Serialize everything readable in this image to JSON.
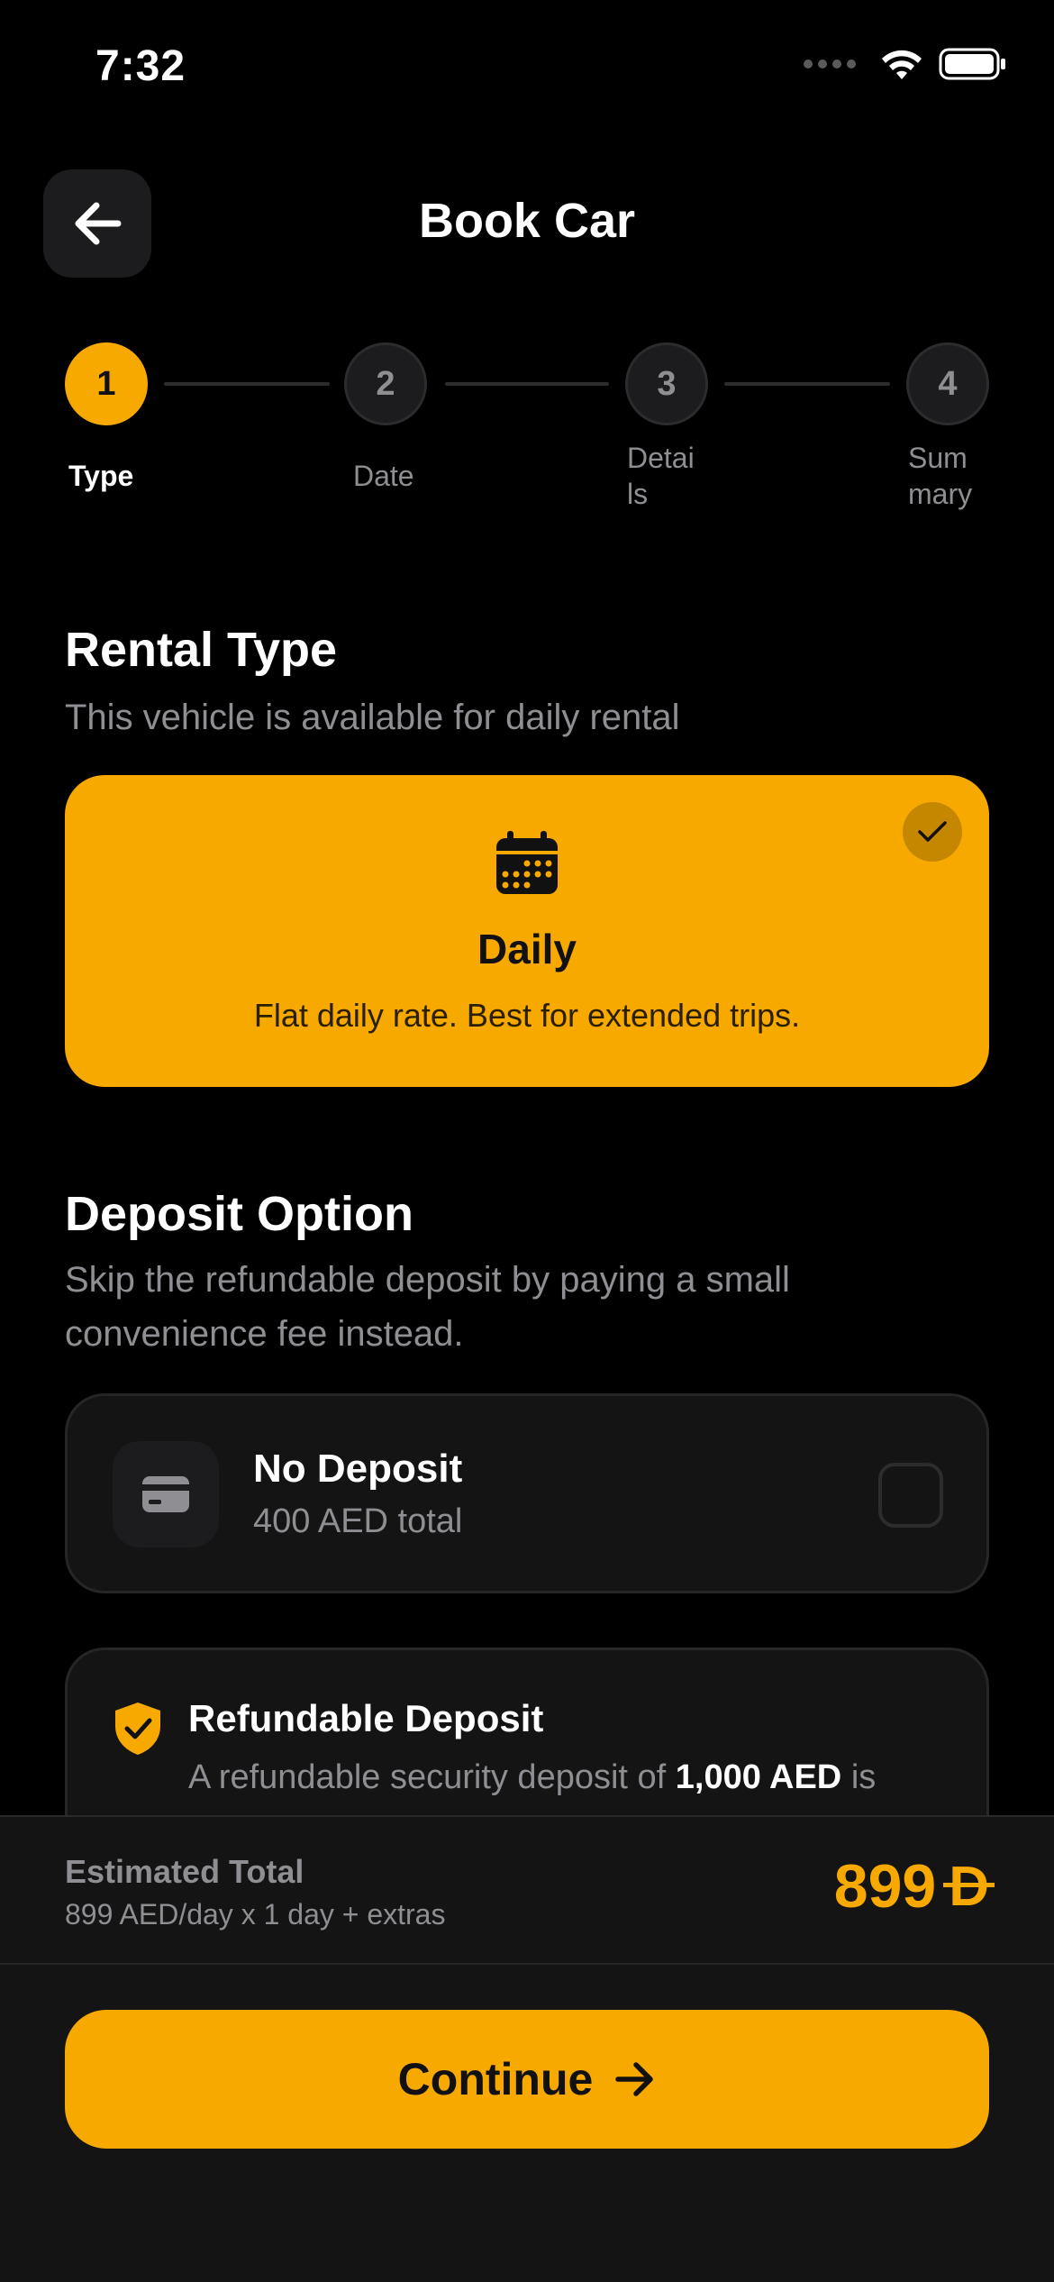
{
  "status_bar": {
    "time": "7:32"
  },
  "header": {
    "title": "Book Car",
    "back_icon": "arrow-left-icon"
  },
  "stepper": {
    "steps": [
      {
        "number": "1",
        "label": "Type",
        "active": true
      },
      {
        "number": "2",
        "label": "Date",
        "active": false
      },
      {
        "number": "3",
        "label": "Detai\nls",
        "active": false
      },
      {
        "number": "4",
        "label": "Sum\nmary",
        "active": false
      }
    ]
  },
  "rental_type": {
    "title": "Rental Type",
    "subtitle": "This vehicle is available for daily rental",
    "option": {
      "icon": "calendar-icon",
      "name": "Daily",
      "description": "Flat daily rate. Best for extended trips.",
      "selected": true
    }
  },
  "deposit": {
    "title": "Deposit Option",
    "subtitle": "Skip the refundable deposit by paying a small convenience fee instead.",
    "no_deposit": {
      "icon": "credit-card-icon",
      "title": "No Deposit",
      "subtitle": "400 AED total",
      "checked": false
    },
    "refundable": {
      "icon": "shield-check-icon",
      "title": "Refundable Deposit",
      "subtitle_before": "A refundable security deposit of ",
      "subtitle_amount": "1,000 AED",
      "subtitle_after": " is"
    }
  },
  "summary": {
    "label": "Estimated Total",
    "detail": "899 AED/day x 1 day + extras",
    "amount": "899",
    "currency_symbol": "D"
  },
  "continue": {
    "label": "Continue",
    "icon": "arrow-right-icon"
  },
  "colors": {
    "accent": "#f7a900",
    "background": "#000000",
    "card": "#141414",
    "muted": "#8e8e93"
  }
}
